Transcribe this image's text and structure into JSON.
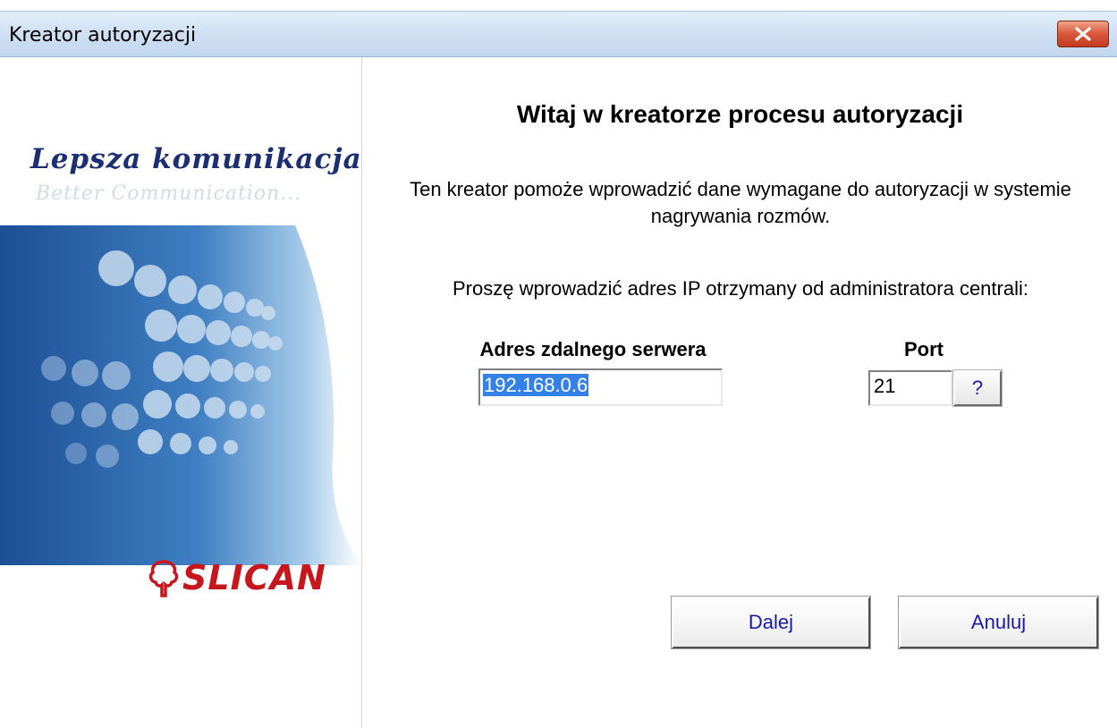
{
  "window": {
    "title": "Kreator autoryzacji"
  },
  "banner": {
    "slogan": "Lepsza komunikacja...",
    "slogan_sub": "Better Communication...",
    "logo_text": "SLICAN",
    "logo_icon": "tree-logo-icon"
  },
  "main": {
    "heading": "Witaj w kreatorze procesu autoryzacji",
    "intro": "Ten kreator pomoże wprowadzić dane wymagane do autoryzacji w systemie nagrywania rozmów.",
    "prompt": "Proszę wprowadzić adres IP otrzymany od administratora centrali:"
  },
  "form": {
    "address_label": "Adres zdalnego serwera",
    "address_value": "192.168.0.6",
    "port_label": "Port",
    "port_value": "21",
    "help_label": "?"
  },
  "buttons": {
    "next": "Dalej",
    "cancel": "Anuluj"
  },
  "colors": {
    "accent_blue": "#1c2f73",
    "logo_red": "#c8161d",
    "close_red": "#c33b22",
    "selection": "#3380e6"
  }
}
